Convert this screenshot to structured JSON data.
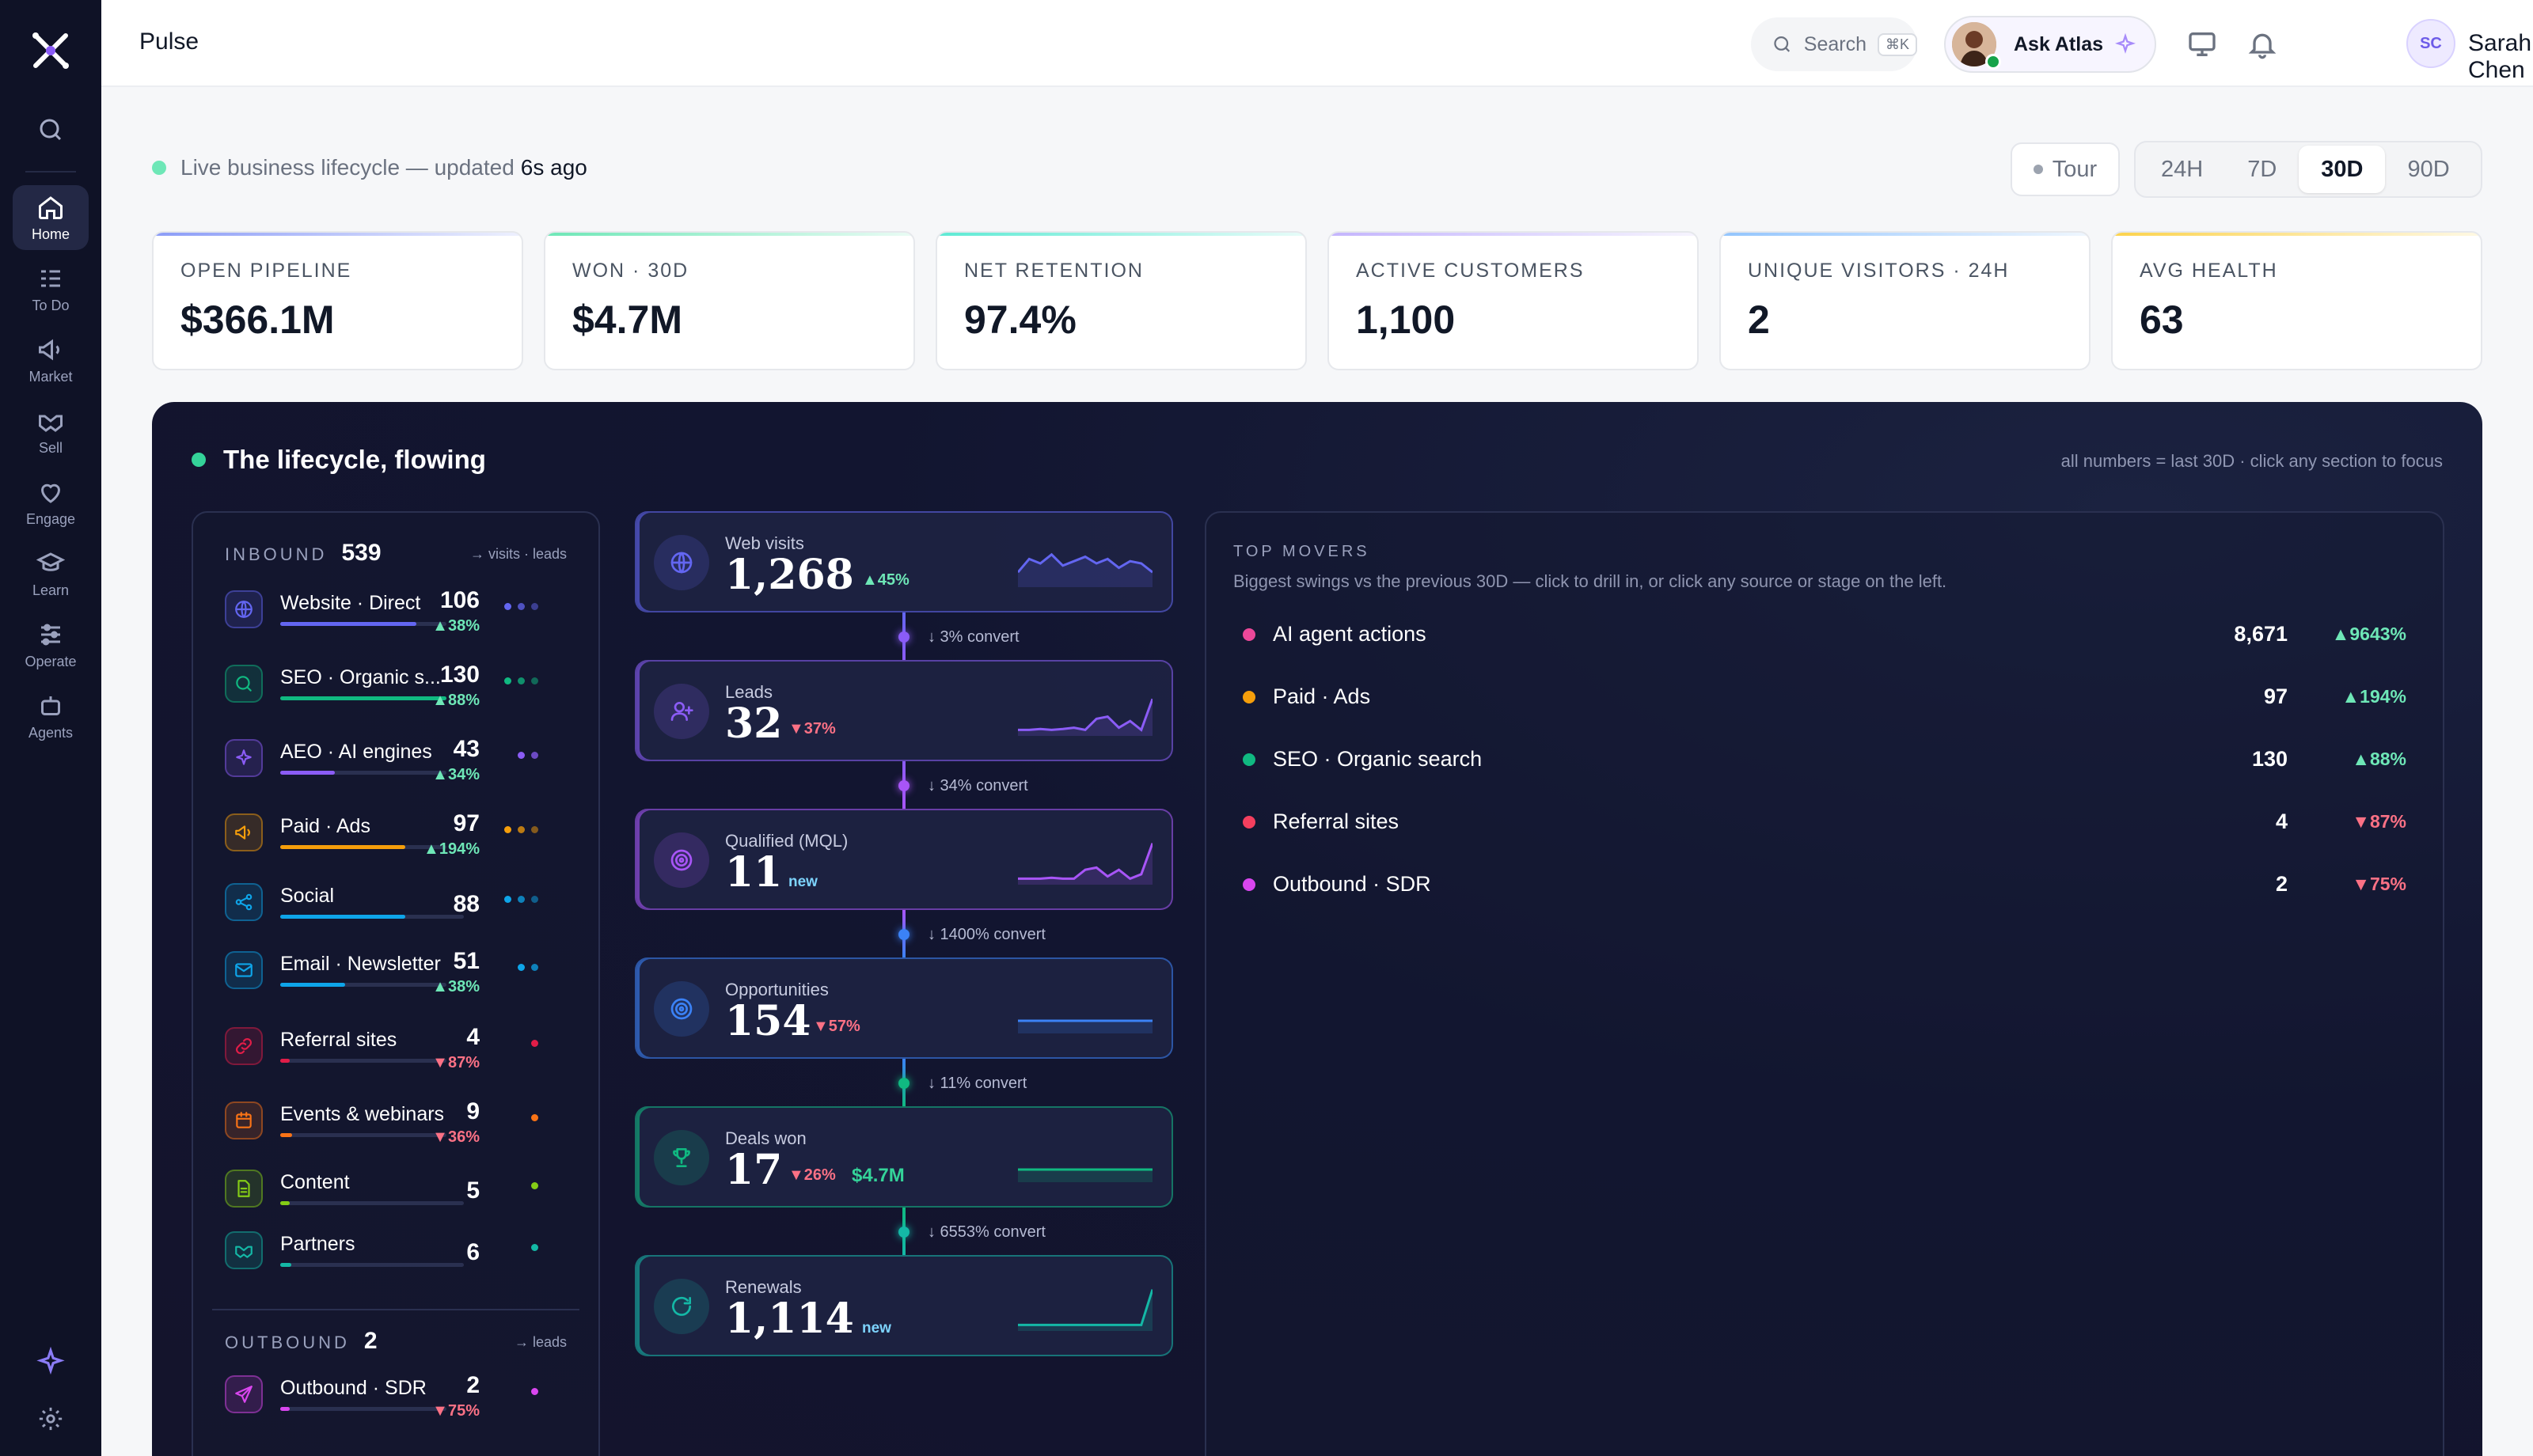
{
  "app": {
    "title": "Pulse"
  },
  "sidebar": {
    "items": [
      {
        "label": "Home",
        "icon": "home-icon",
        "active": true
      },
      {
        "label": "To Do",
        "icon": "todo-icon"
      },
      {
        "label": "Market",
        "icon": "megaphone-icon"
      },
      {
        "label": "Sell",
        "icon": "handshake-icon"
      },
      {
        "label": "Engage",
        "icon": "heart-hand-icon"
      },
      {
        "label": "Learn",
        "icon": "graduation-cap-icon"
      },
      {
        "label": "Operate",
        "icon": "sliders-icon"
      },
      {
        "label": "Agents",
        "icon": "robot-icon"
      }
    ]
  },
  "topbar": {
    "search_label": "Search",
    "search_shortcut": "⌘K",
    "ask_label": "Ask Atlas",
    "user_initials": "SC",
    "user_name": "Sarah Chen"
  },
  "status": {
    "text": "Live business lifecycle — updated",
    "age": "6s ago"
  },
  "controls": {
    "tour_label": "Tour",
    "ranges": [
      "24H",
      "7D",
      "30D",
      "90D"
    ],
    "active_range": "30D"
  },
  "kpis": [
    {
      "label": "OPEN PIPELINE",
      "value": "$366.1M",
      "accent": "#8b9cf7"
    },
    {
      "label": "WON · 30D",
      "value": "$4.7M",
      "accent": "#6ee7b7"
    },
    {
      "label": "NET RETENTION",
      "value": "97.4%",
      "accent": "#5eead4"
    },
    {
      "label": "ACTIVE CUSTOMERS",
      "value": "1,100",
      "accent": "#c4b5fd"
    },
    {
      "label": "UNIQUE VISITORS · 24H",
      "value": "2",
      "accent": "#93c5fd"
    },
    {
      "label": "AVG HEALTH",
      "value": "63",
      "accent": "#fcd34d"
    }
  ],
  "flow": {
    "title": "The lifecycle, flowing",
    "note": "all numbers = last 30D · click any section to focus",
    "inbound": {
      "label": "INBOUND",
      "count": "539",
      "hint": "→ visits · leads",
      "sources": [
        {
          "name": "Website · Direct",
          "value": "106",
          "delta": "▲38%",
          "trend": "up",
          "fill": 0.82,
          "color": "#6366f1",
          "icon": "globe-icon"
        },
        {
          "name": "SEO · Organic s...",
          "value": "130",
          "delta": "▲88%",
          "trend": "up",
          "fill": 1.0,
          "color": "#10b981",
          "icon": "search-icon"
        },
        {
          "name": "AEO · AI engines",
          "value": "43",
          "delta": "▲34%",
          "trend": "up",
          "fill": 0.33,
          "color": "#8b5cf6",
          "icon": "sparkle-icon"
        },
        {
          "name": "Paid · Ads",
          "value": "97",
          "delta": "▲194%",
          "trend": "up",
          "fill": 0.75,
          "color": "#f59e0b",
          "icon": "megaphone-icon"
        },
        {
          "name": "Social",
          "value": "88",
          "delta": "",
          "trend": "flat",
          "fill": 0.68,
          "color": "#0ea5e9",
          "icon": "share-icon"
        },
        {
          "name": "Email · Newsletter",
          "value": "51",
          "delta": "▲38%",
          "trend": "up",
          "fill": 0.39,
          "color": "#0ea5e9",
          "icon": "mail-icon"
        },
        {
          "name": "Referral sites",
          "value": "4",
          "delta": "▼87%",
          "trend": "down",
          "fill": 0.04,
          "color": "#e11d48",
          "icon": "link-icon"
        },
        {
          "name": "Events & webinars",
          "value": "9",
          "delta": "▼36%",
          "trend": "down",
          "fill": 0.07,
          "color": "#f97316",
          "icon": "calendar-icon"
        },
        {
          "name": "Content",
          "value": "5",
          "delta": "",
          "trend": "flat",
          "fill": 0.05,
          "color": "#84cc16",
          "icon": "document-icon"
        },
        {
          "name": "Partners",
          "value": "6",
          "delta": "",
          "trend": "flat",
          "fill": 0.06,
          "color": "#14b8a6",
          "icon": "handshake-icon"
        }
      ]
    },
    "outbound": {
      "label": "OUTBOUND",
      "count": "2",
      "hint": "→ leads",
      "sources": [
        {
          "name": "Outbound · SDR",
          "value": "2",
          "delta": "▼75%",
          "trend": "down",
          "fill": 0.04,
          "color": "#d946ef",
          "icon": "send-icon"
        }
      ]
    },
    "stages": [
      {
        "label": "Web visits",
        "value": "1,268",
        "delta": "▲45%",
        "trend": "up",
        "extra": "",
        "color": "#6366f1",
        "icon": "globe-icon",
        "spark": [
          0.7,
          0.4,
          0.5,
          0.3,
          0.55,
          0.45,
          0.35,
          0.5,
          0.4,
          0.6,
          0.45,
          0.5,
          0.7
        ]
      },
      {
        "label": "Leads",
        "value": "32",
        "delta": "▼37%",
        "trend": "down",
        "extra": "",
        "color": "#8b5cf6",
        "icon": "user-plus-icon",
        "spark": [
          0.9,
          0.9,
          0.88,
          0.9,
          0.88,
          0.85,
          0.9,
          0.65,
          0.6,
          0.85,
          0.7,
          0.9,
          0.2
        ]
      },
      {
        "label": "Qualified (MQL)",
        "value": "11",
        "delta": "",
        "trend": "",
        "extra": "new",
        "color": "#a855f7",
        "icon": "target-icon",
        "spark": [
          0.9,
          0.9,
          0.9,
          0.88,
          0.9,
          0.9,
          0.7,
          0.65,
          0.85,
          0.7,
          0.9,
          0.8,
          0.1
        ]
      },
      {
        "label": "Opportunities",
        "value": "154",
        "delta": "▼57%",
        "trend": "down",
        "extra": "",
        "color": "#3b82f6",
        "icon": "target-icon",
        "spark": [
          0.75,
          0.75,
          0.75,
          0.75,
          0.75,
          0.75,
          0.75,
          0.75,
          0.75,
          0.75,
          0.75,
          0.75,
          0.75
        ]
      },
      {
        "label": "Deals won",
        "value": "17",
        "delta": "▼26%",
        "trend": "down",
        "extra": "$4.7M",
        "color": "#10b981",
        "icon": "trophy-icon",
        "spark": [
          0.75,
          0.75,
          0.75,
          0.75,
          0.75,
          0.75,
          0.75,
          0.75,
          0.75,
          0.75,
          0.75,
          0.75,
          0.75
        ]
      },
      {
        "label": "Renewals",
        "value": "1,114",
        "delta": "",
        "trend": "",
        "extra": "new",
        "color": "#14b8a6",
        "icon": "refresh-icon",
        "spark": [
          0.9,
          0.9,
          0.9,
          0.9,
          0.9,
          0.9,
          0.9,
          0.9,
          0.9,
          0.9,
          0.9,
          0.9,
          0.1
        ]
      }
    ],
    "conversions": [
      "↓ 3% convert",
      "↓ 34% convert",
      "↓ 1400% convert",
      "↓ 11% convert",
      "↓ 6553% convert"
    ],
    "movers": {
      "title": "TOP MOVERS",
      "subtitle": "Biggest swings vs the previous 30D — click to drill in, or click any source or stage on the left.",
      "items": [
        {
          "name": "AI agent actions",
          "value": "8,671",
          "delta": "▲9643%",
          "trend": "up",
          "color": "#ec4899"
        },
        {
          "name": "Paid · Ads",
          "value": "97",
          "delta": "▲194%",
          "trend": "up",
          "color": "#f59e0b"
        },
        {
          "name": "SEO · Organic search",
          "value": "130",
          "delta": "▲88%",
          "trend": "up",
          "color": "#10b981"
        },
        {
          "name": "Referral sites",
          "value": "4",
          "delta": "▼87%",
          "trend": "down",
          "color": "#f43f5e"
        },
        {
          "name": "Outbound · SDR",
          "value": "2",
          "delta": "▼75%",
          "trend": "down",
          "color": "#d946ef"
        }
      ]
    }
  }
}
